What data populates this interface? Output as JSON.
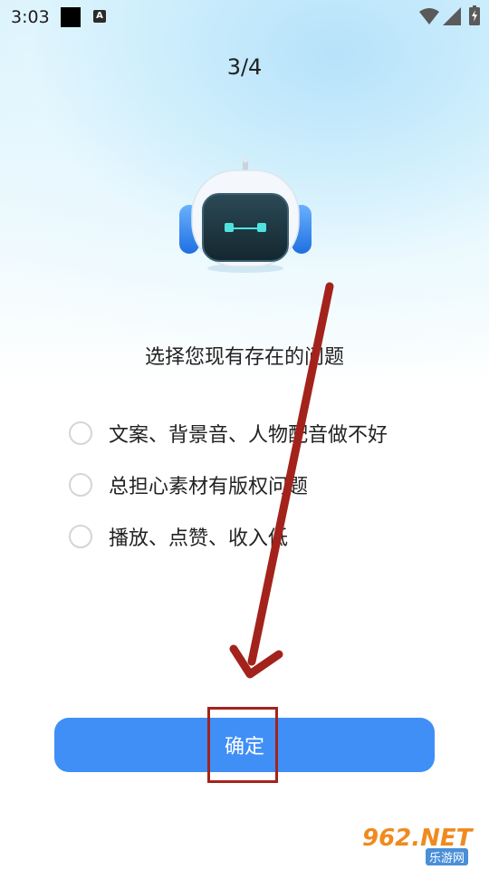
{
  "status_bar": {
    "time": "3:03",
    "notification_icon_label": "A"
  },
  "header": {
    "progress": "3/4"
  },
  "mascot": {
    "icon": "robot-icon"
  },
  "survey": {
    "question": "选择您现有存在的问题",
    "options": [
      {
        "label": "文案、背景音、人物配音做不好",
        "selected": false
      },
      {
        "label": "总担心素材有版权问题",
        "selected": false
      },
      {
        "label": "播放、点赞、收入低",
        "selected": false
      }
    ]
  },
  "footer": {
    "confirm_label": "确定"
  },
  "colors": {
    "accent": "#3f8ff7",
    "annotation": "#a3231c"
  },
  "watermark": {
    "main": "962.NET",
    "sub": "乐游网"
  }
}
